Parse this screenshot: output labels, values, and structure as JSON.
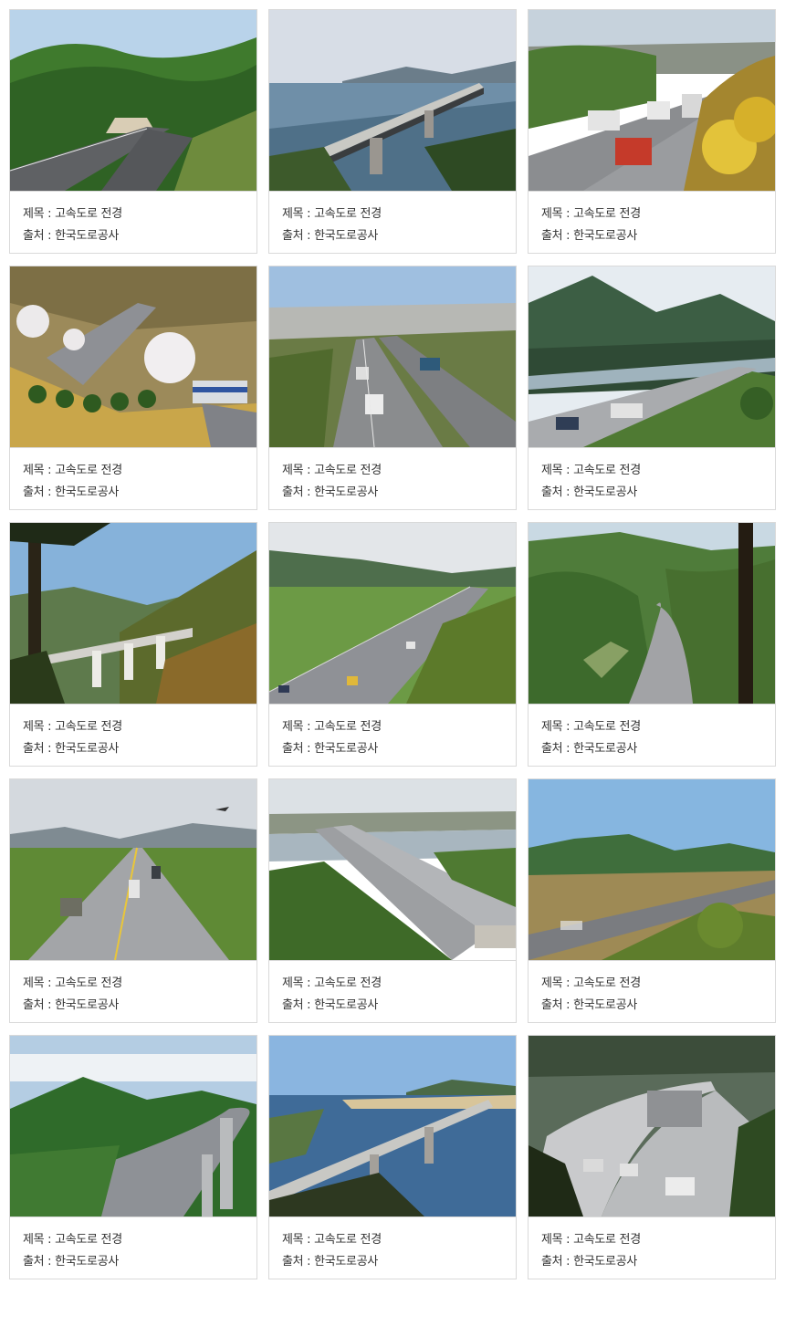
{
  "gallery": {
    "items": [
      {
        "title_line": "제목 : 고속도로 전경",
        "source_line": "출처 : 한국도로공사",
        "scene": "mountain-tunnel-highway"
      },
      {
        "title_line": "제목 : 고속도로 전경",
        "source_line": "출처 : 한국도로공사",
        "scene": "bridge-over-estuary"
      },
      {
        "title_line": "제목 : 고속도로 전경",
        "source_line": "출처 : 한국도로공사",
        "scene": "highway-trucks-forsythia"
      },
      {
        "title_line": "제목 : 고속도로 전경",
        "source_line": "출처 : 한국도로공사",
        "scene": "cherry-blossom-garden-highway"
      },
      {
        "title_line": "제목 : 고속도로 전경",
        "source_line": "출처 : 한국도로공사",
        "scene": "highway-to-city"
      },
      {
        "title_line": "제목 : 고속도로 전경",
        "source_line": "출처 : 한국도로공사",
        "scene": "valley-river-highway"
      },
      {
        "title_line": "제목 : 고속도로 전경",
        "source_line": "출처 : 한국도로공사",
        "scene": "viaduct-pine-trees"
      },
      {
        "title_line": "제목 : 고속도로 전경",
        "source_line": "출처 : 한국도로공사",
        "scene": "highway-through-fields"
      },
      {
        "title_line": "제목 : 고속도로 전경",
        "source_line": "출처 : 한국도로공사",
        "scene": "winding-highway-valley"
      },
      {
        "title_line": "제목 : 고속도로 전경",
        "source_line": "출처 : 한국도로공사",
        "scene": "highway-airplane-farmland"
      },
      {
        "title_line": "제목 : 고속도로 전경",
        "source_line": "출처 : 한국도로공사",
        "scene": "highway-river-bridge"
      },
      {
        "title_line": "제목 : 고속도로 전경",
        "source_line": "출처 : 한국도로공사",
        "scene": "highway-mountains-blur"
      },
      {
        "title_line": "제목 : 고속도로 전경",
        "source_line": "출처 : 한국도로공사",
        "scene": "curved-elevated-highway"
      },
      {
        "title_line": "제목 : 고속도로 전경",
        "source_line": "출처 : 한국도로공사",
        "scene": "bridge-across-bay"
      },
      {
        "title_line": "제목 : 고속도로 전경",
        "source_line": "출처 : 한국도로공사",
        "scene": "elevated-highway-cars"
      }
    ]
  }
}
